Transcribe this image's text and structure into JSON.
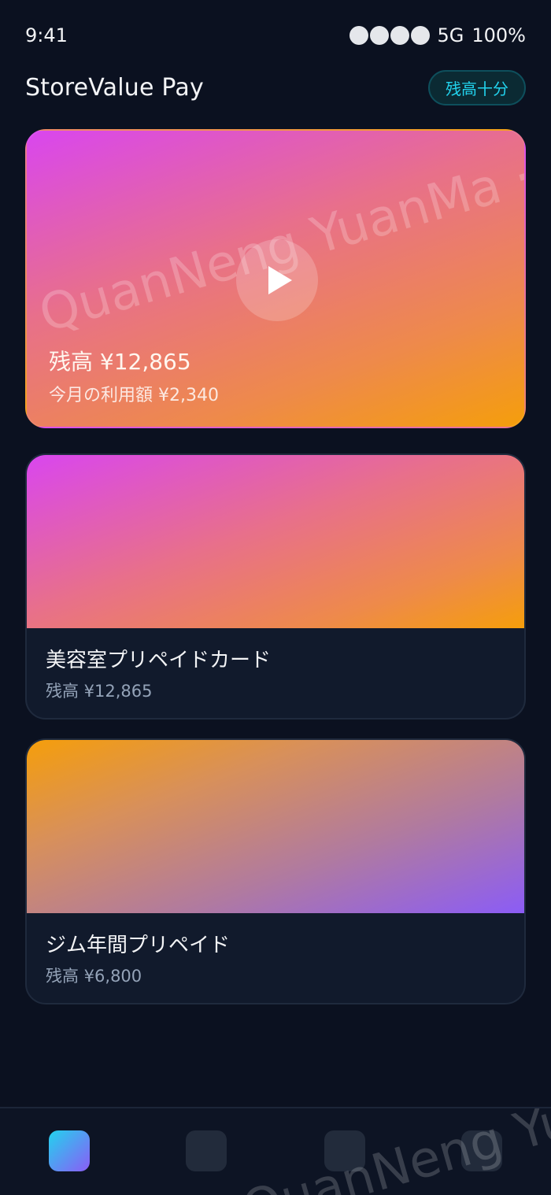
{
  "status_bar": {
    "time": "9:41",
    "network": "5G",
    "battery": "100%",
    "signal_bars": 4
  },
  "header": {
    "title": "StoreValue Pay",
    "badge": "残高十分"
  },
  "hero_card": {
    "watermark": "QuanNeng YuanMa · in",
    "play_icon": "play-icon",
    "balance": "残高 ¥12,865",
    "monthly_usage": "今月の利用額 ¥2,340"
  },
  "cards": [
    {
      "title": "美容室プリペイドカード",
      "balance": "残高 ¥12,865"
    },
    {
      "title": "ジム年間プリペイド",
      "balance": "残高 ¥6,800"
    }
  ],
  "bottom_nav": {
    "watermark": "QuanNeng YuanMa",
    "items": [
      {
        "icon": "home-icon",
        "active": true
      },
      {
        "icon": "cards-icon",
        "active": false
      },
      {
        "icon": "history-icon",
        "active": false
      },
      {
        "icon": "settings-icon",
        "active": false
      }
    ]
  },
  "colors": {
    "background": "#0b1120",
    "accent": "#22d3ee",
    "gradient_pink": "#d946ef",
    "gradient_orange": "#f59e0b",
    "gradient_purple": "#8b5cf6"
  }
}
